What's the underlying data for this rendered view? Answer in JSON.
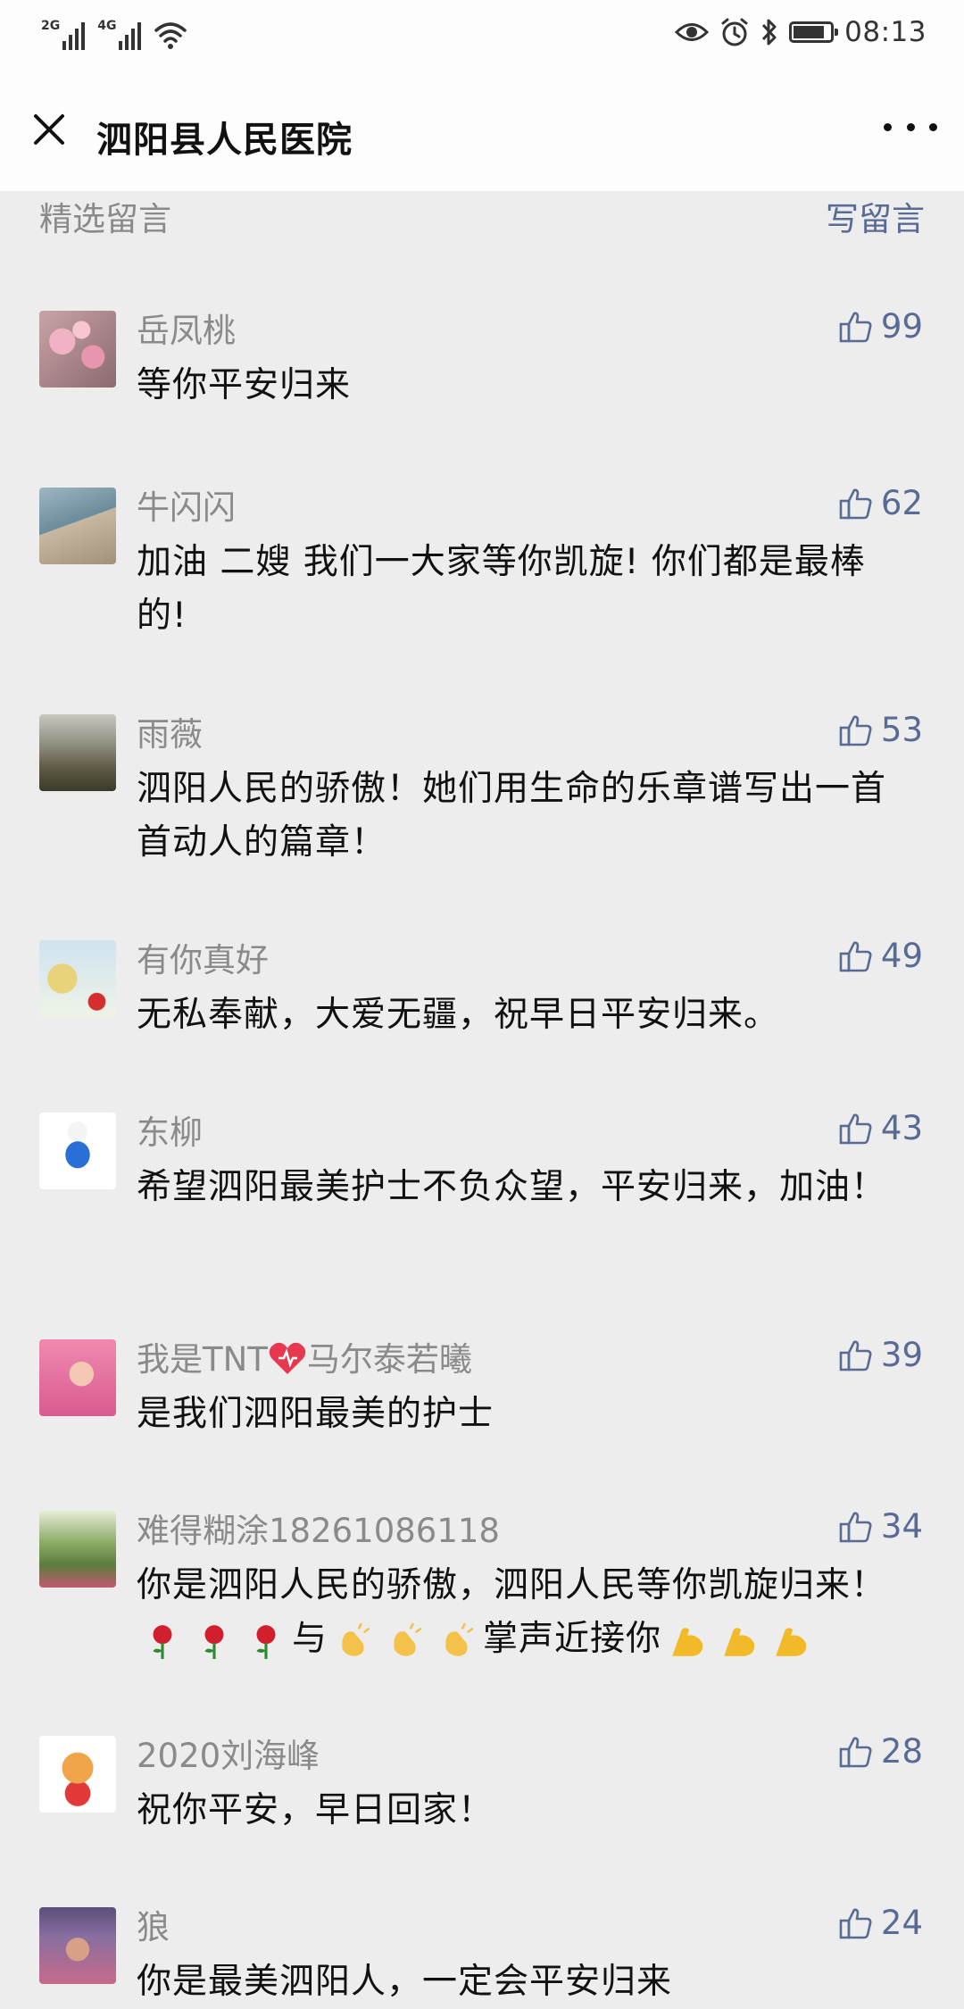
{
  "status_bar": {
    "network_1": "2G",
    "network_2": "4G",
    "time": "08:13",
    "battery_level": 0.85
  },
  "title_bar": {
    "title": "泗阳县人民医院"
  },
  "section": {
    "title": "精选留言",
    "write_link": "写留言"
  },
  "comments": [
    {
      "name": "岳凤桃",
      "likes": "99",
      "text": "等你平安归来"
    },
    {
      "name": "牛闪闪",
      "likes": "62",
      "text": "加油 二嫂  我们一大家等你凯旋! 你们都是最棒的!"
    },
    {
      "name": "雨薇",
      "likes": "53",
      "text": "泗阳人民的骄傲！她们用生命的乐章谱写出一首首动人的篇章！"
    },
    {
      "name": "有你真好",
      "likes": "49",
      "text": "无私奉献，大爱无疆，祝早日平安归来。"
    },
    {
      "name": "东柳",
      "likes": "43",
      "text": "希望泗阳最美护士不负众望，平安归来，加油！"
    },
    {
      "name_prefix": "我是TNT",
      "name_suffix": "马尔泰若曦",
      "likes": "39",
      "text": "是我们泗阳最美的护士"
    },
    {
      "name": "难得糊涂18261086118",
      "likes": "34",
      "text_a": "你是泗阳人民的骄傲，泗阳人民等你凯旋归来！",
      "text_b": "与",
      "text_c": "掌声近接你"
    },
    {
      "name": "2020刘海峰",
      "likes": "28",
      "text": "祝你平安，早日回家！"
    },
    {
      "name": "狼",
      "likes": "24",
      "text": "你是最美泗阳人，一定会平安归来"
    }
  ],
  "colors": {
    "link": "#576b95",
    "secondary_text": "#8a8a8a",
    "background": "#ededed"
  },
  "icons": {
    "close": "close-icon",
    "more": "more-icon",
    "like": "thumbs-up-icon",
    "heart": "heart-icon",
    "rose": "rose-icon",
    "clap": "clapping-hands-icon",
    "muscle": "flexed-biceps-icon"
  }
}
